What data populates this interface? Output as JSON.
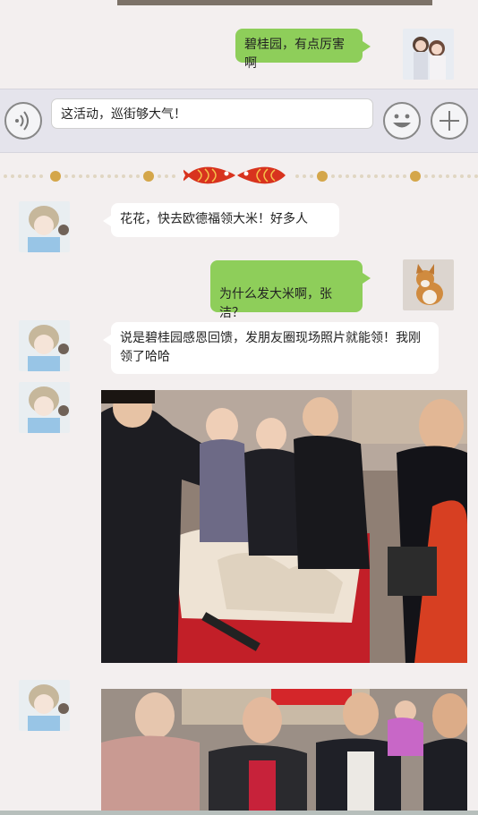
{
  "messages": {
    "m1": "碧桂园，有点厉害啊",
    "m2": "花花，快去欧德福领大米！好多人",
    "m3": "为什么发大米啊，张洁？",
    "m4": "说是碧桂园感恩回馈，发朋友圈现场照片就能领！我刚领了哈哈"
  },
  "input": {
    "value": "这活动，巡街够大气！"
  },
  "icons": {
    "voice": "voice-icon",
    "emoji": "emoji-icon",
    "add": "plus-icon",
    "divider": "fish-ornament-icon"
  },
  "colors": {
    "background": "#f3efef",
    "bubble_sent": "#8ece5a",
    "bubble_received": "#ffffff",
    "divider_dot": "#d4a64a",
    "fish": "#d8331e"
  }
}
